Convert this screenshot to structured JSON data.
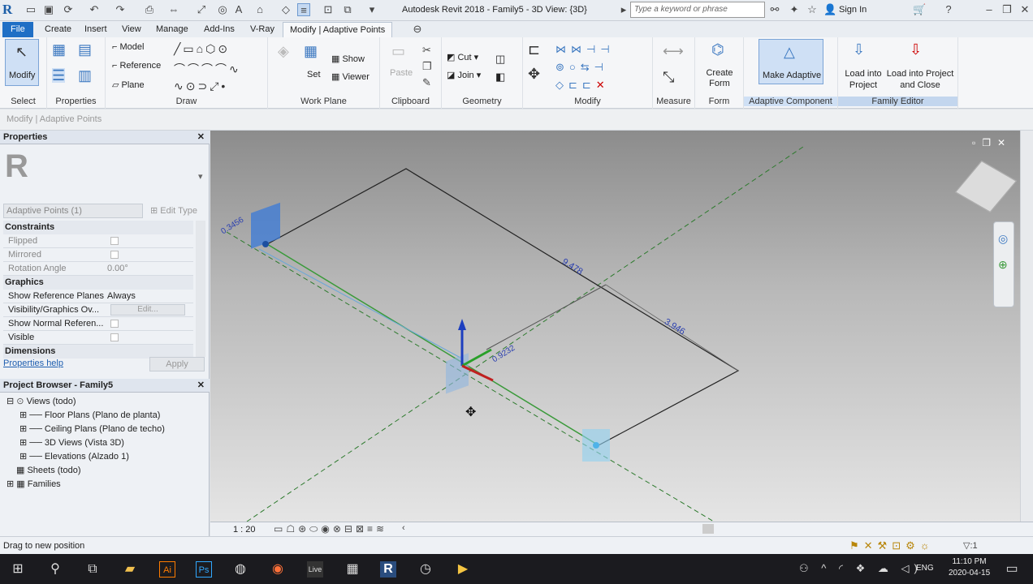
{
  "app": {
    "title": "Autodesk Revit 2018 -   Family5 - 3D View: {3D}",
    "search_placeholder": "Type a keyword or phrase",
    "sign_in": "Sign In",
    "accent": "#1f6fc5"
  },
  "tabs": [
    "File",
    "Create",
    "Insert",
    "View",
    "Manage",
    "Add-Ins",
    "V-Ray",
    "Modify | Adaptive Points"
  ],
  "ribbon": {
    "select": {
      "label": "Modify",
      "panel": "Select"
    },
    "properties": {
      "panel": "Properties"
    },
    "draw": {
      "model": "Model",
      "reference": "Reference",
      "plane": "Plane",
      "panel": "Draw"
    },
    "workplane": {
      "set": "Set",
      "show": "Show",
      "viewer": "Viewer",
      "panel": "Work Plane"
    },
    "clipboard": {
      "paste": "Paste",
      "panel": "Clipboard"
    },
    "geometry": {
      "cut": "Cut",
      "join": "Join",
      "panel": "Geometry"
    },
    "modify": {
      "panel": "Modify"
    },
    "measure": {
      "panel": "Measure"
    },
    "form": {
      "label": "Create Form",
      "panel": "Form"
    },
    "adaptive": {
      "label": "Make Adaptive",
      "panel": "Adaptive Component"
    },
    "family_editor": {
      "load": "Load into Project",
      "load_close": "Load into Project and Close",
      "panel": "Family Editor"
    }
  },
  "context_bar": "Modify | Adaptive Points",
  "properties": {
    "header": "Properties",
    "type": "Adaptive Points (1)",
    "edit_type": "Edit Type",
    "sections": [
      {
        "name": "Constraints",
        "rows": [
          {
            "k": "Flipped",
            "v": ""
          },
          {
            "k": "Mirrored",
            "v": ""
          },
          {
            "k": "Rotation Angle",
            "v": "0.00°"
          }
        ]
      },
      {
        "name": "Graphics",
        "rows": [
          {
            "k": "Show Reference Planes",
            "v": "Always"
          },
          {
            "k": "Visibility/Graphics Ov...",
            "v": "Edit..."
          },
          {
            "k": "Show Normal Referen...",
            "v": ""
          },
          {
            "k": "Visible",
            "v": ""
          }
        ]
      },
      {
        "name": "Dimensions",
        "rows": []
      }
    ],
    "help_link": "Properties help",
    "apply": "Apply"
  },
  "browser": {
    "header": "Project Browser - Family5",
    "items": [
      {
        "label": "Views (todo)",
        "level": 0
      },
      {
        "label": "Floor Plans (Plano de planta)",
        "level": 1
      },
      {
        "label": "Ceiling Plans (Plano de techo)",
        "level": 1
      },
      {
        "label": "3D Views (Vista 3D)",
        "level": 1
      },
      {
        "label": "Elevations (Alzado 1)",
        "level": 1
      },
      {
        "label": "Sheets (todo)",
        "level": 0
      },
      {
        "label": "Families",
        "level": 0
      }
    ]
  },
  "viewport": {
    "dims": [
      "0.3456",
      "9.478",
      "3.946",
      "0.9232"
    ],
    "scale": "1 : 20"
  },
  "status": "Drag to new position",
  "taskbar": {
    "lang": "ENG",
    "time": "11:10 PM",
    "date": "2020-04-15"
  }
}
